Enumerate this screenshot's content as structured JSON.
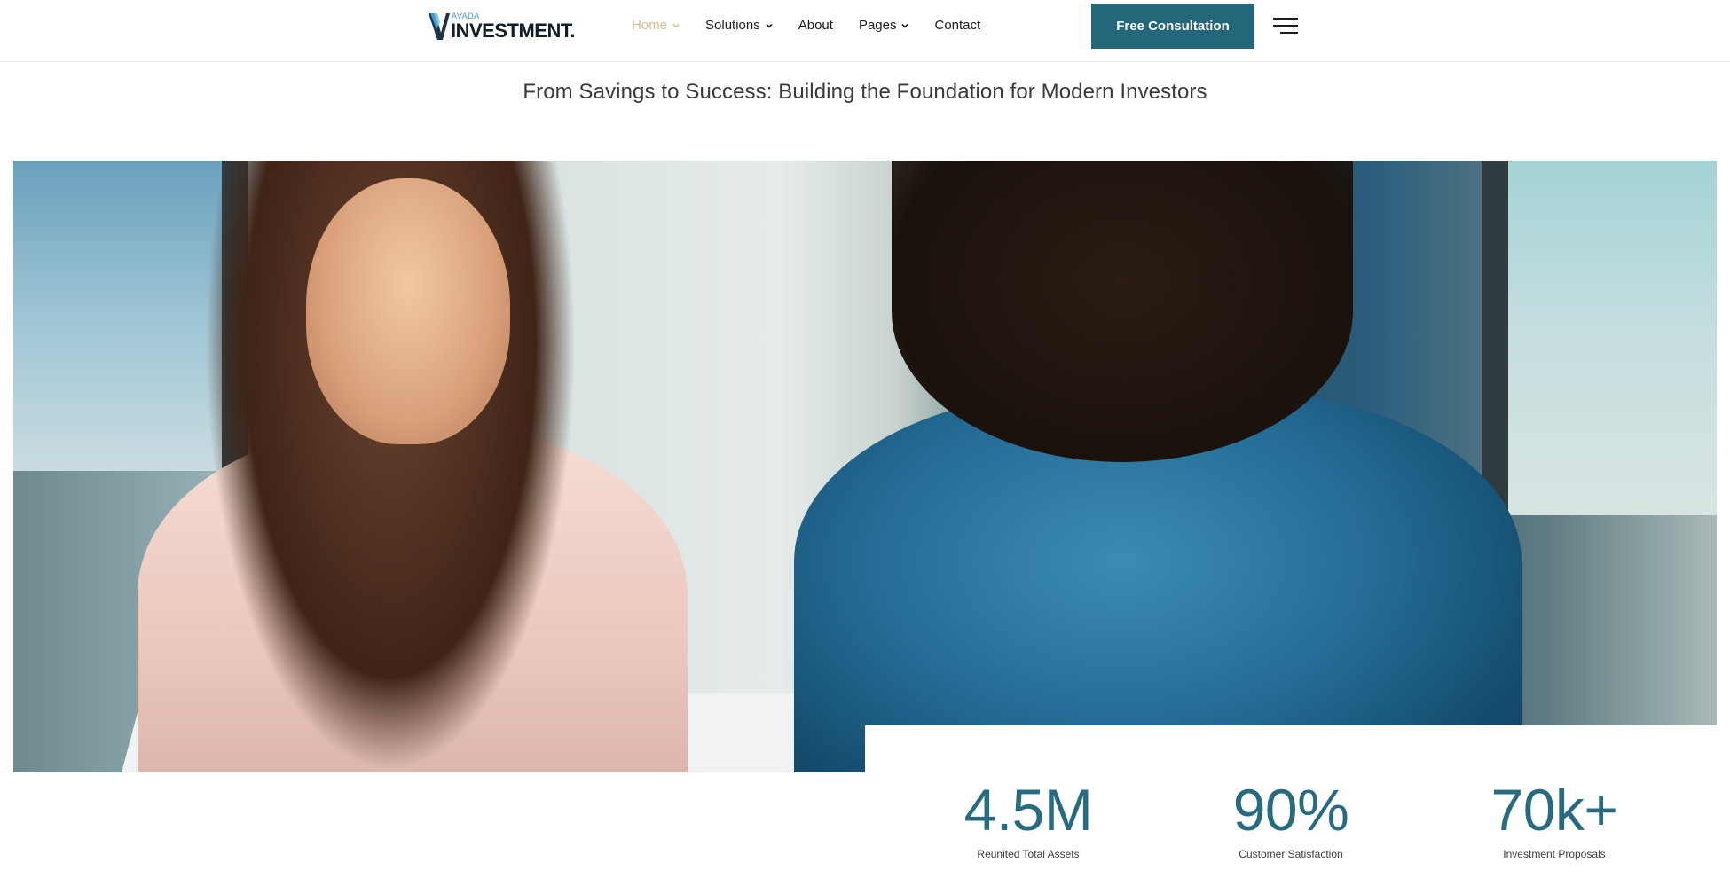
{
  "header": {
    "logo_small": "AVADA",
    "logo_text": "INVESTMENT.",
    "nav": [
      {
        "label": "Home",
        "has_dropdown": true,
        "active": true
      },
      {
        "label": "Solutions",
        "has_dropdown": true,
        "active": false
      },
      {
        "label": "About",
        "has_dropdown": false,
        "active": false
      },
      {
        "label": "Pages",
        "has_dropdown": true,
        "active": false
      },
      {
        "label": "Contact",
        "has_dropdown": false,
        "active": false
      }
    ],
    "cta_label": "Free Consultation",
    "menu_icon": "hamburger-icon"
  },
  "hero": {
    "tagline": "From Savings to Success: Building the Foundation for Modern Investors"
  },
  "stats": [
    {
      "value": "4.5M",
      "label": "Reunited Total Assets"
    },
    {
      "value": "90%",
      "label": "Customer Satisfaction"
    },
    {
      "value": "70k+",
      "label": "Investment Proposals"
    }
  ],
  "colors": {
    "accent": "#24677b",
    "nav_active": "#d9be8f",
    "stat_value": "#276b80"
  }
}
